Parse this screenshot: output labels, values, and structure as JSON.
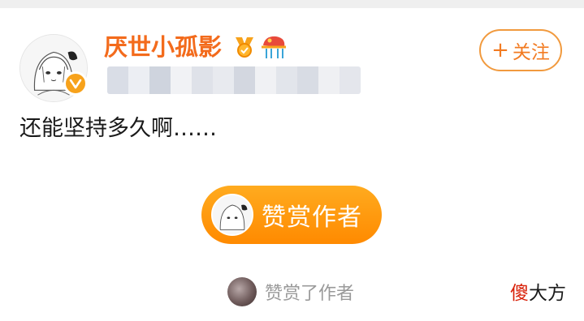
{
  "post": {
    "username": "厌世小孤影",
    "text": "还能坚持多久啊……",
    "follow": {
      "plus": "+",
      "label": "关注"
    }
  },
  "tip": {
    "button_label": "赞赏作者",
    "tippers_label": "赞赏了作者"
  },
  "watermark": {
    "first": "傻",
    "rest": "大方"
  },
  "icons": {
    "verified": "verified-v-icon",
    "medal": "medal-icon",
    "hat": "hat-icon"
  },
  "colors": {
    "accent": "#f36b1c",
    "follow_border": "#f19a3e",
    "tip_gradient_top": "#ffab1f",
    "tip_gradient_bottom": "#ff8a00",
    "verified": "#f7a21b"
  }
}
